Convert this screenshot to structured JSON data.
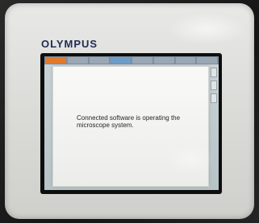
{
  "device": {
    "brand_logo": "OLYMPUS"
  },
  "screen": {
    "taskbar_tabs": 8,
    "dialog": {
      "message": "Connected software is operating the microscope system."
    }
  },
  "colors": {
    "bezel": "#dcdcd9",
    "logo": "#1f2b55",
    "active_tab": "#e07a2c",
    "dialog_bg": "#f5f5f3",
    "text": "#262626"
  }
}
